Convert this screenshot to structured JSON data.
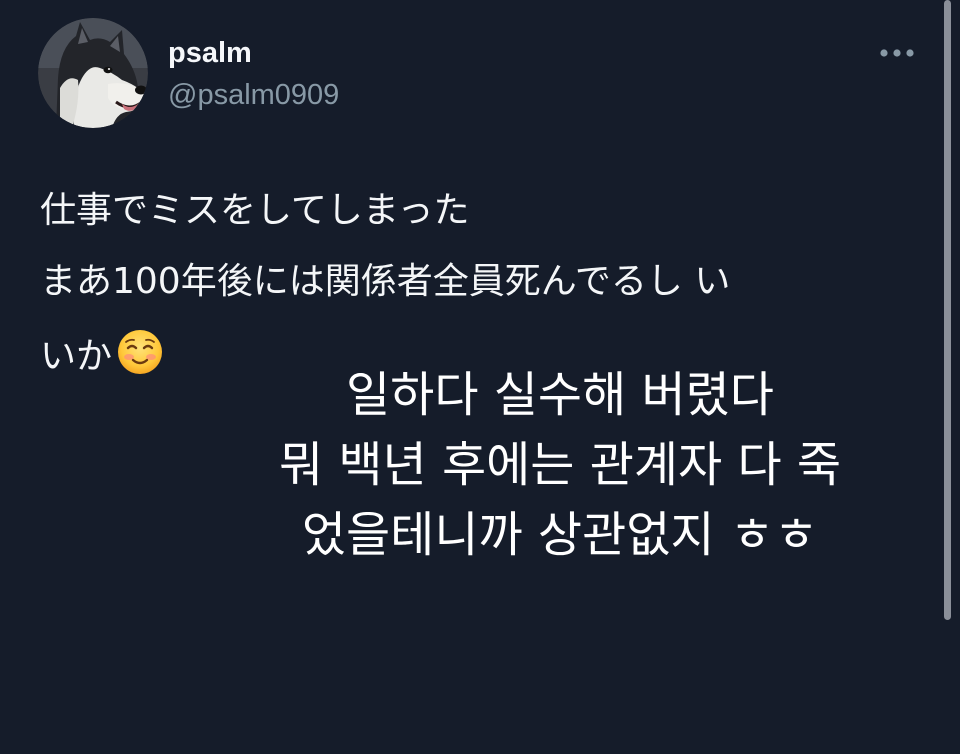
{
  "user": {
    "display_name": "psalm",
    "handle": "@psalm0909",
    "avatar_icon": "husky-dog-avatar"
  },
  "more_menu": {
    "icon": "more-horizontal-icon"
  },
  "tweet": {
    "lines": [
      "仕事でミスをしてしまった",
      "まあ100年後には関係者全員死んでるし い",
      "いか"
    ],
    "emoji": "smiling-face-emoji"
  },
  "overlay_caption": {
    "lines": [
      "일하다 실수해 버렸다",
      "뭐 백년 후에는 관계자 다 죽",
      "었을테니까 상관없지 ㅎㅎ"
    ]
  },
  "colors": {
    "background": "#151c2a",
    "handle": "#8899a6",
    "text": "#f4f6f8"
  }
}
